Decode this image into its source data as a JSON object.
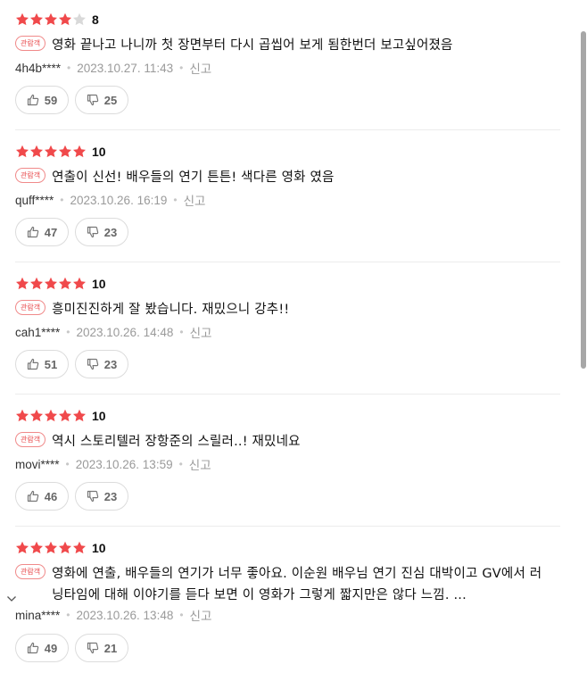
{
  "reviews": [
    {
      "stars_filled": 4,
      "stars_total": 5,
      "score": "8",
      "badge": "관람객",
      "text": "영화 끝나고 나니까 첫 장면부터 다시 곱씹어 보게 됨한번더 보고싶어졌음",
      "user": "4h4b****",
      "date": "2023.10.27. 11:43",
      "report": "신고",
      "likes": "59",
      "dislikes": "25"
    },
    {
      "stars_filled": 5,
      "stars_total": 5,
      "score": "10",
      "badge": "관람객",
      "text": "연출이 신선! 배우들의 연기 튼튼! 색다른 영화 였음",
      "user": "quff****",
      "date": "2023.10.26. 16:19",
      "report": "신고",
      "likes": "47",
      "dislikes": "23"
    },
    {
      "stars_filled": 5,
      "stars_total": 5,
      "score": "10",
      "badge": "관람객",
      "text": "흥미진진하게 잘 봤습니다. 재밌으니 강추!!",
      "user": "cah1****",
      "date": "2023.10.26. 14:48",
      "report": "신고",
      "likes": "51",
      "dislikes": "23"
    },
    {
      "stars_filled": 5,
      "stars_total": 5,
      "score": "10",
      "badge": "관람객",
      "text": "역시 스토리텔러 장항준의 스릴러..! 재밌네요",
      "user": "movi****",
      "date": "2023.10.26. 13:59",
      "report": "신고",
      "likes": "46",
      "dislikes": "23"
    },
    {
      "stars_filled": 5,
      "stars_total": 5,
      "score": "10",
      "badge": "관람객",
      "text": "영화에 연출, 배우들의 연기가 너무 좋아요. 이순원 배우님 연기 진심 대박이고 GV에서 러닝타임에 대해 이야기를 듣다 보면 이 영화가 그렇게 짧지만은 않다 느낌. ...",
      "user": "mina****",
      "date": "2023.10.26. 13:48",
      "report": "신고",
      "likes": "49",
      "dislikes": "21"
    }
  ],
  "colors": {
    "star_filled": "#f0494b",
    "star_empty": "#d9d9d9",
    "badge": "#e8494b"
  },
  "icons": {
    "like": "thumbs-up-icon",
    "dislike": "thumbs-down-icon",
    "expand": "chevron-down-icon"
  }
}
